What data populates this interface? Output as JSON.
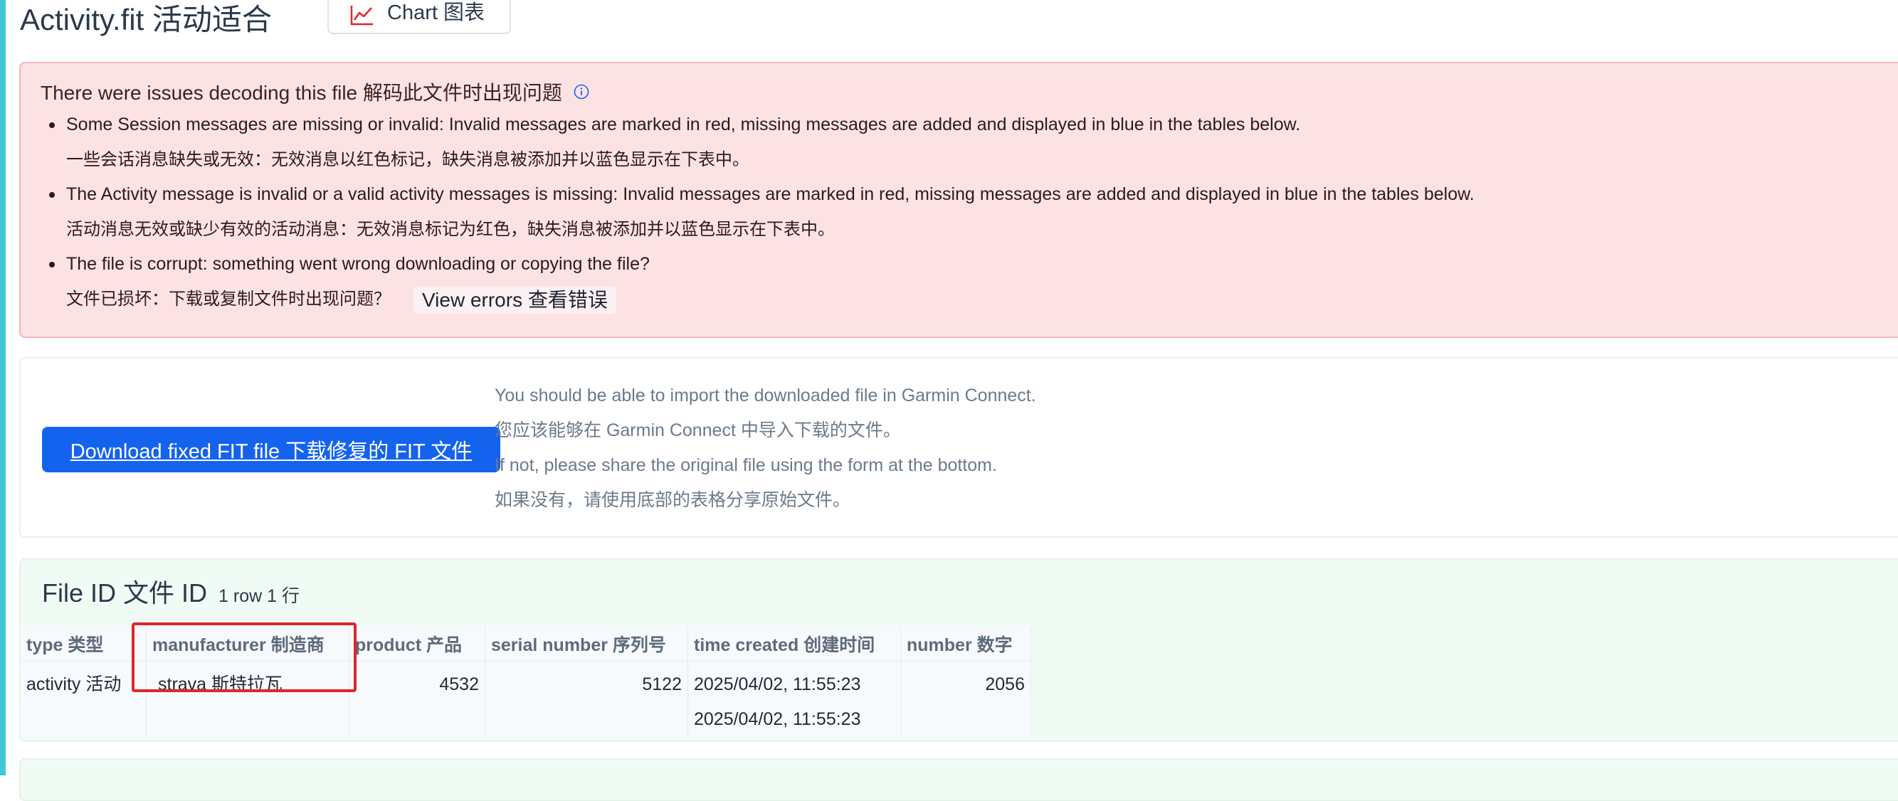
{
  "page": {
    "title": "Activity.fit  活动适合",
    "chart_button_label": "Chart  图表"
  },
  "alert": {
    "heading": "There were issues decoding this file  解码此文件时出现问题",
    "items": [
      {
        "text": "Some Session messages are missing or invalid: Invalid messages are marked in red, missing messages are added and displayed in blue in the tables below.",
        "sub": "一些会话消息缺失或无效：无效消息以红色标记，缺失消息被添加并以蓝色显示在下表中。"
      },
      {
        "text": "The Activity message is invalid or a valid activity messages is missing: Invalid messages are marked in red, missing messages are added and displayed in blue in the tables below.",
        "sub": "活动消息无效或缺少有效的活动消息：无效消息标记为红色，缺失消息被添加并以蓝色显示在下表中。"
      },
      {
        "text": "The file is corrupt: something went wrong downloading or copying the file?",
        "sub": "文件已损坏：下载或复制文件时出现问题？"
      }
    ],
    "view_errors_label": "View errors  查看错误"
  },
  "download": {
    "button_label": "Download fixed FIT file  下载修复的 FIT 文件",
    "info_lines": [
      "You should be able to import the downloaded file in Garmin Connect.",
      "您应该能够在 Garmin Connect 中导入下载的文件。",
      "If not, please share the original file using the form at the bottom.",
      "如果没有，请使用底部的表格分享原始文件。"
    ]
  },
  "file_id": {
    "title": "File ID  文件 ID",
    "row_count": "1 row  1 行",
    "columns": [
      "type  类型",
      "manufacturer  制造商",
      "product  产品",
      "serial number  序列号",
      "time created  创建时间",
      "number  数字"
    ],
    "rows": [
      {
        "type": "activity  活动",
        "manufacturer": "strava  斯特拉瓦",
        "product": "4532",
        "serial_number": "5122",
        "time_created": "2025/04/02,  11:55:23",
        "time_created_alt": "2025/04/02,  11:55:23",
        "number": "2056"
      }
    ]
  },
  "colors": {
    "accent_stripe": "#3ec8d6",
    "alert_bg": "#fde2e4",
    "primary_button": "#1463ef",
    "highlight_box": "#e0262b",
    "table_section_bg": "#f1fbf5"
  },
  "icons": {
    "chart": "line-chart-icon",
    "info": "info-circle-icon"
  }
}
